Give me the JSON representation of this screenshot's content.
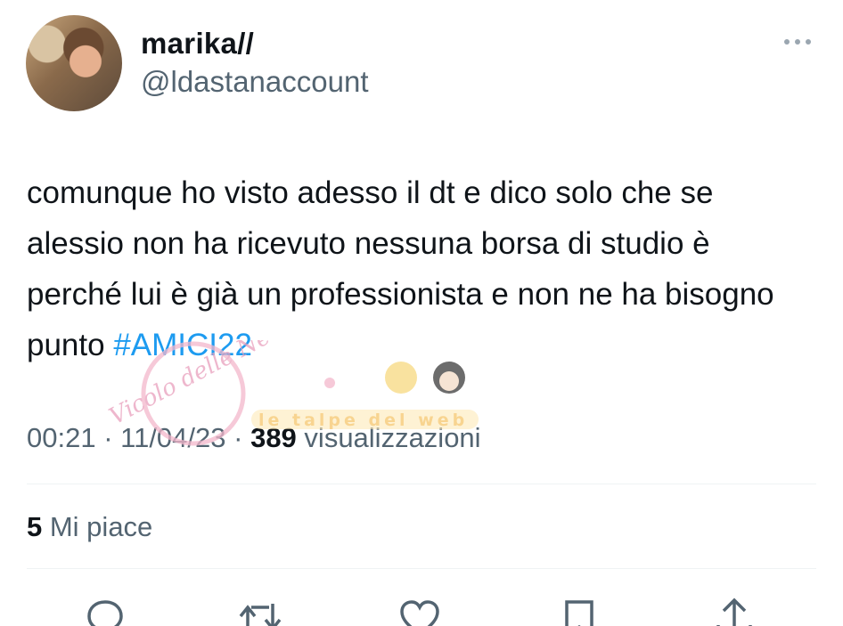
{
  "user": {
    "display_name": "marika//",
    "handle": "@ldastanaccount"
  },
  "tweet": {
    "text": "comunque ho visto adesso il dt e dico solo che se alessio non ha ricevuto nessuna borsa di studio è perché lui è già un professionista e non ne ha bisogno punto ",
    "hashtag": "#AMICI22"
  },
  "meta": {
    "time": "00:21",
    "separator1": " · ",
    "date": "11/04/23",
    "separator2": " · ",
    "views_count": "389",
    "views_label": " visualizzazioni"
  },
  "stats": {
    "likes_count": "5",
    "likes_label": " Mi piace"
  },
  "watermarks": {
    "left": "Vicolo delle News",
    "right": "le talpe del web"
  },
  "icons": {
    "more": "more-horizontal-icon",
    "reply": "reply-icon",
    "retweet": "retweet-icon",
    "like": "heart-icon",
    "bookmark": "bookmark-icon",
    "share": "share-icon"
  },
  "colors": {
    "hashtag": "#1d9bf0",
    "secondary_text": "#536471",
    "primary_text": "#0f1419"
  }
}
